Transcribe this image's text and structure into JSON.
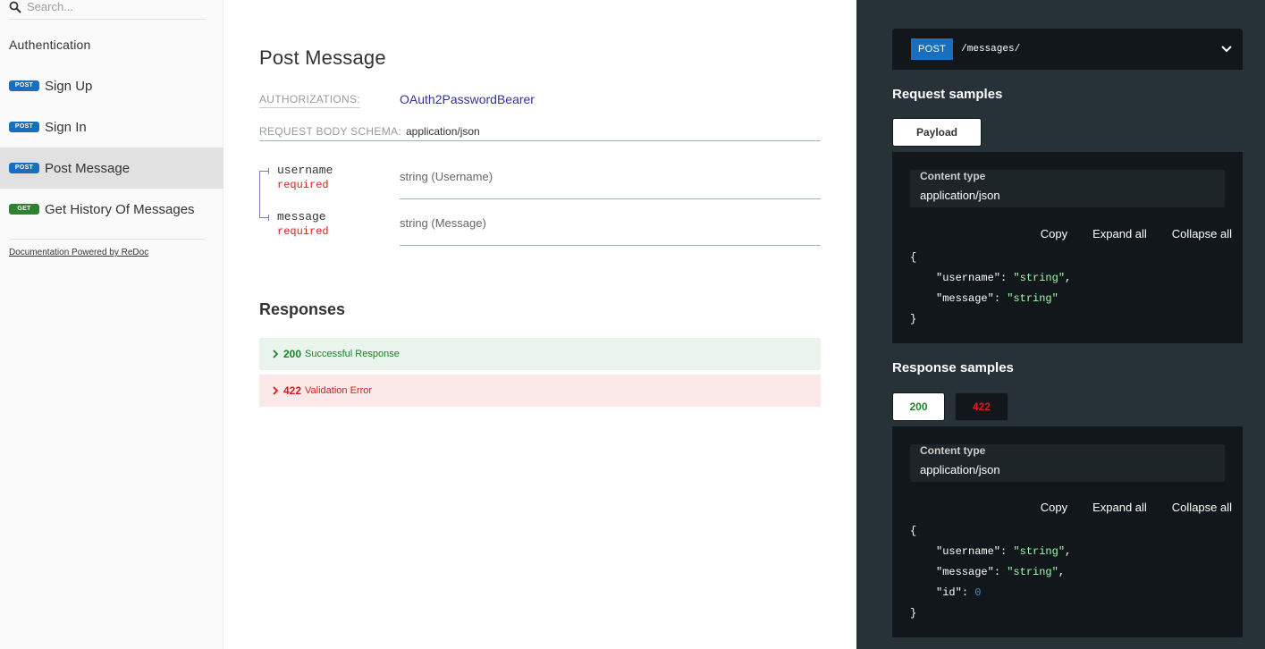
{
  "sidebar": {
    "search_placeholder": "Search...",
    "group_label": "Authentication",
    "items": [
      {
        "method": "POST",
        "label": "Sign Up"
      },
      {
        "method": "POST",
        "label": "Sign In"
      },
      {
        "method": "POST",
        "label": "Post Message"
      },
      {
        "method": "GET",
        "label": "Get History Of Messages"
      }
    ],
    "powered_by": "Documentation Powered by ReDoc"
  },
  "operation": {
    "title": "Post Message",
    "authorizations_label": "AUTHORIZATIONS:",
    "authorizations_value": "OAuth2PasswordBearer",
    "schema_label": "REQUEST BODY SCHEMA:",
    "schema_value": "application/json",
    "params": [
      {
        "name": "username",
        "required": "required",
        "type": "string (Username)"
      },
      {
        "name": "message",
        "required": "required",
        "type": "string (Message)"
      }
    ],
    "responses_title": "Responses",
    "responses": [
      {
        "code": "200",
        "description": "Successful Response"
      },
      {
        "code": "422",
        "description": "Validation Error"
      }
    ]
  },
  "right_panel": {
    "endpoint_method": "POST",
    "endpoint_path": "/messages/",
    "request_samples_title": "Request samples",
    "request_tab": "Payload",
    "response_samples_title": "Response samples",
    "response_tabs": [
      "200",
      "422"
    ],
    "content_type_label": "Content type",
    "content_type_value": "application/json",
    "copy_label": "Copy",
    "expand_label": "Expand all",
    "collapse_label": "Collapse all",
    "request_json": {
      "open": "{",
      "username_key": "\"username\"",
      "username_value": "\"string\"",
      "message_key": "\"message\"",
      "message_value": "\"string\"",
      "close": "}"
    },
    "response_json": {
      "open": "{",
      "username_key": "\"username\"",
      "username_value": "\"string\"",
      "message_key": "\"message\"",
      "message_value": "\"string\"",
      "id_key": "\"id\"",
      "id_value": "0",
      "close": "}"
    }
  },
  "colors": {
    "post_badge": "#186fbf",
    "get_badge": "#2f8132",
    "success": "#1d8127",
    "error": "#d41f1c",
    "right_bg": "#263238",
    "code_bg": "#11171a",
    "string_value": "#a0fbaa",
    "link": "#32329f"
  }
}
